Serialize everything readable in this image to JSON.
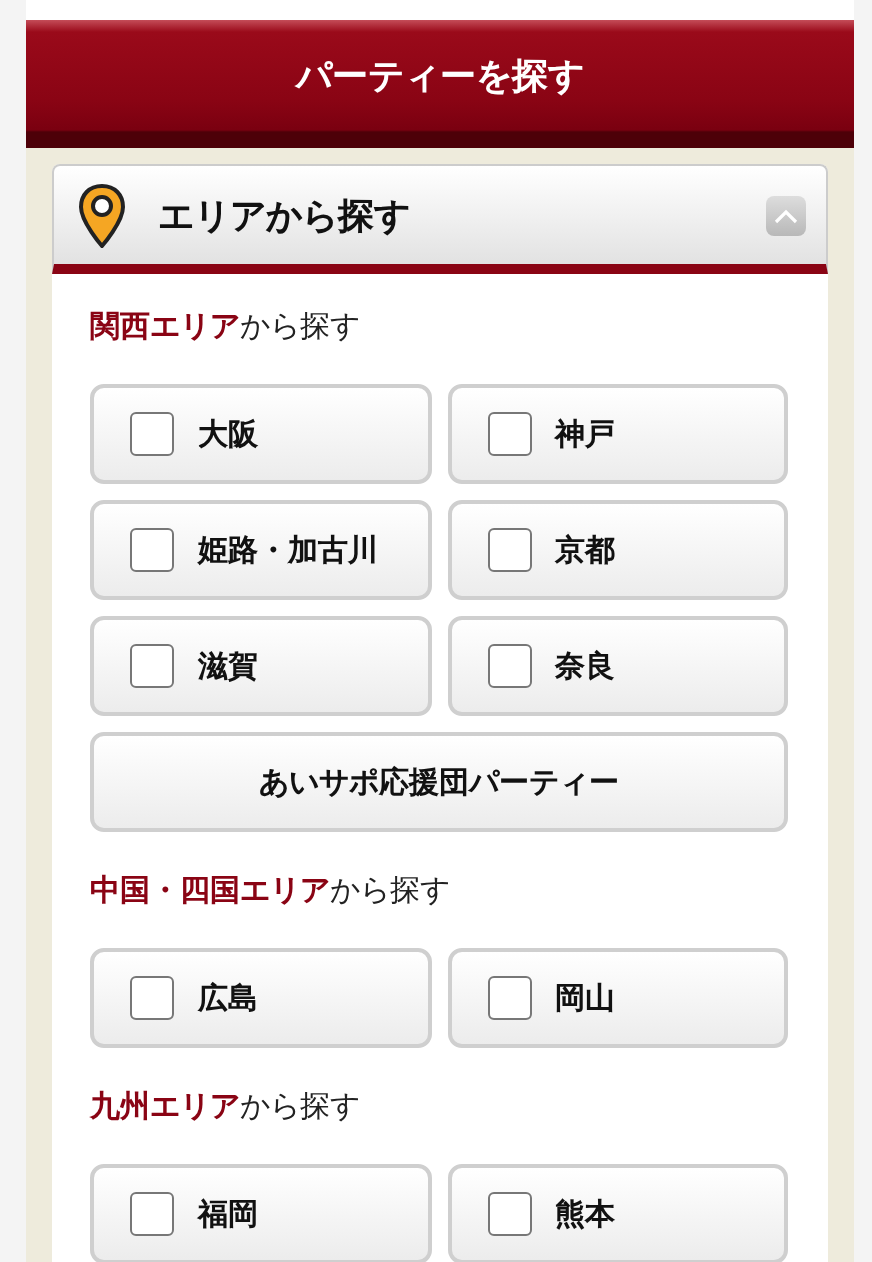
{
  "header": {
    "title": "パーティーを探す"
  },
  "panel": {
    "title": "エリアから探す",
    "expanded": true,
    "sections": [
      {
        "heading": "**関西エリア**から探す",
        "options": [
          {
            "kind": "check",
            "label": "大阪",
            "checked": false
          },
          {
            "kind": "check",
            "label": "神戸",
            "checked": false
          },
          {
            "kind": "check",
            "label": "姫路・加古川",
            "checked": false
          },
          {
            "kind": "check",
            "label": "京都",
            "checked": false
          },
          {
            "kind": "check",
            "label": "滋賀",
            "checked": false
          },
          {
            "kind": "check",
            "label": "奈良",
            "checked": false
          },
          {
            "kind": "wide",
            "label": "あいサポ応援団パーティー"
          }
        ]
      },
      {
        "heading": "**中国・四国エリア**から探す",
        "options": [
          {
            "kind": "check",
            "label": "広島",
            "checked": false
          },
          {
            "kind": "check",
            "label": "岡山",
            "checked": false
          }
        ]
      },
      {
        "heading": "**九州エリア**から探す",
        "options": [
          {
            "kind": "check",
            "label": "福岡",
            "checked": false
          },
          {
            "kind": "check",
            "label": "熊本",
            "checked": false
          }
        ]
      }
    ]
  }
}
